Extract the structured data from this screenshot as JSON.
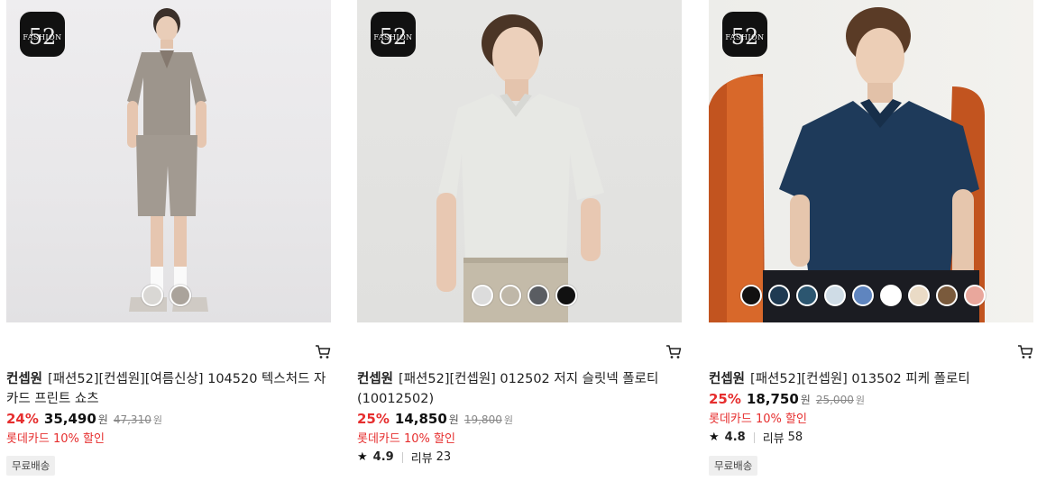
{
  "products": [
    {
      "badge_number": "52",
      "badge_word": "FASHION",
      "brand": "컨셉원",
      "name": "[패션52][컨셉원][여름신상] 104520 텍스처드 자카드 프린트 쇼츠",
      "discount": "24%",
      "sale_price": "35,490",
      "currency": "원",
      "original_price": "47,310",
      "card_promo": "롯데카드 10% 할인",
      "free_shipping": "무료배송",
      "swatches": [
        "#d9d7d4",
        "#aaa39b"
      ]
    },
    {
      "badge_number": "52",
      "badge_word": "FASHION",
      "brand": "컨셉원",
      "name": "[패션52][컨셉원] 012502 저지 슬릿넥 폴로티 (10012502)",
      "discount": "25%",
      "sale_price": "14,850",
      "currency": "원",
      "original_price": "19,800",
      "card_promo": "롯데카드 10% 할인",
      "rating": "4.9",
      "review_label": "리뷰",
      "review_count": "23",
      "swatches": [
        "#dcdcdc",
        "#bfb7a8",
        "#5a5d62",
        "#111111"
      ]
    },
    {
      "badge_number": "52",
      "badge_word": "FASHION",
      "brand": "컨셉원",
      "name": "[패션52][컨셉원] 013502 피케 폴로티",
      "discount": "25%",
      "sale_price": "18,750",
      "currency": "원",
      "original_price": "25,000",
      "card_promo": "롯데카드 10% 할인",
      "rating": "4.8",
      "review_label": "리뷰",
      "review_count": "58",
      "free_shipping": "무료배송",
      "swatches": [
        "#111111",
        "#1f3a52",
        "#2c5670",
        "#cfdce6",
        "#5f85bf",
        "#ffffff",
        "#eadbc6",
        "#7a5a3c",
        "#e9a79c"
      ]
    }
  ],
  "icons": {
    "cart": "cart-icon",
    "star": "star-icon"
  }
}
